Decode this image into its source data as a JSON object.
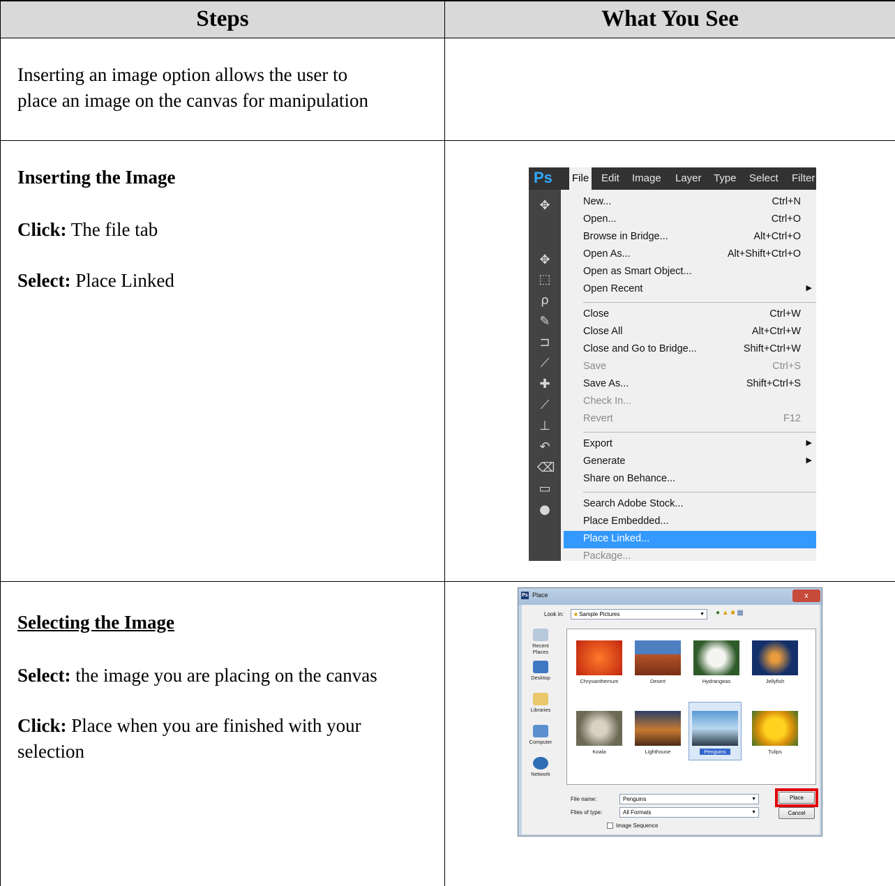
{
  "table": {
    "headers": [
      "Steps",
      "What You See"
    ],
    "intro": "Inserting an image option allows the user to place an image on the canvas for manipulation",
    "intro_lines": [
      "Inserting an image option allows the user to",
      "place an image on the canvas for manipulation"
    ]
  },
  "step_insert": {
    "heading": "Inserting the Image",
    "click_label": "Click:",
    "click_text": " The file tab",
    "select_label": "Select:",
    "select_text": " Place Linked"
  },
  "step_select": {
    "heading": "Selecting the Image",
    "select_label": "Select:",
    "select_text": " the image you are placing on the canvas",
    "click_label": "Click:",
    "click_text_line1": " Place when you are finished with your",
    "click_text_line2": "selection"
  },
  "photoshop": {
    "logo": "Ps",
    "menubar": [
      "File",
      "Edit",
      "Image",
      "Layer",
      "Type",
      "Select",
      "Filter"
    ],
    "tool_icons": [
      "move-tool-icon",
      "marquee-tool-icon",
      "lasso-tool-icon",
      "quick-select-tool-icon",
      "crop-tool-icon",
      "eyedropper-tool-icon",
      "healing-tool-icon",
      "brush-tool-icon",
      "stamp-tool-icon",
      "history-brush-tool-icon",
      "eraser-tool-icon",
      "gradient-tool-icon",
      "blur-tool-icon"
    ],
    "file_menu": [
      {
        "label": "New...",
        "shortcut": "Ctrl+N"
      },
      {
        "label": "Open...",
        "shortcut": "Ctrl+O"
      },
      {
        "label": "Browse in Bridge...",
        "shortcut": "Alt+Ctrl+O"
      },
      {
        "label": "Open As...",
        "shortcut": "Alt+Shift+Ctrl+O"
      },
      {
        "label": "Open as Smart Object...",
        "shortcut": ""
      },
      {
        "label": "Open Recent",
        "shortcut": "",
        "submenu": true
      },
      {
        "label": "Close",
        "shortcut": "Ctrl+W"
      },
      {
        "label": "Close All",
        "shortcut": "Alt+Ctrl+W"
      },
      {
        "label": "Close and Go to Bridge...",
        "shortcut": "Shift+Ctrl+W"
      },
      {
        "label": "Save",
        "shortcut": "Ctrl+S",
        "disabled": true
      },
      {
        "label": "Save As...",
        "shortcut": "Shift+Ctrl+S"
      },
      {
        "label": "Check In...",
        "shortcut": "",
        "disabled": true
      },
      {
        "label": "Revert",
        "shortcut": "F12",
        "disabled": true
      },
      {
        "label": "Export",
        "shortcut": "",
        "submenu": true
      },
      {
        "label": "Generate",
        "shortcut": "",
        "submenu": true
      },
      {
        "label": "Share on Behance...",
        "shortcut": ""
      },
      {
        "label": "Search Adobe Stock...",
        "shortcut": ""
      },
      {
        "label": "Place Embedded...",
        "shortcut": ""
      },
      {
        "label": "Place Linked...",
        "shortcut": "",
        "selected": true
      },
      {
        "label": "Package...",
        "shortcut": "",
        "disabled": true
      }
    ],
    "selected_color": "#3399ff"
  },
  "place_dialog": {
    "title": "Place",
    "close_label": "x",
    "look_in_label": "Look in:",
    "look_in_value": "Sample Pictures",
    "places": [
      "Recent Places",
      "Desktop",
      "Libraries",
      "Computer",
      "Network"
    ],
    "files": [
      "Chrysanthemum",
      "Desert",
      "Hydrangeas",
      "Jellyfish",
      "Koala",
      "Lighthouse",
      "Penguins",
      "Tulips"
    ],
    "selected_file": "Penguins",
    "file_name_label": "File name:",
    "file_name_value": "Penguins",
    "file_type_label": "Files of type:",
    "file_type_value": "All Formats",
    "place_button": "Place",
    "cancel_button": "Cancel",
    "sequence_label": "Image Sequence",
    "highlight_color": "#e00000"
  }
}
